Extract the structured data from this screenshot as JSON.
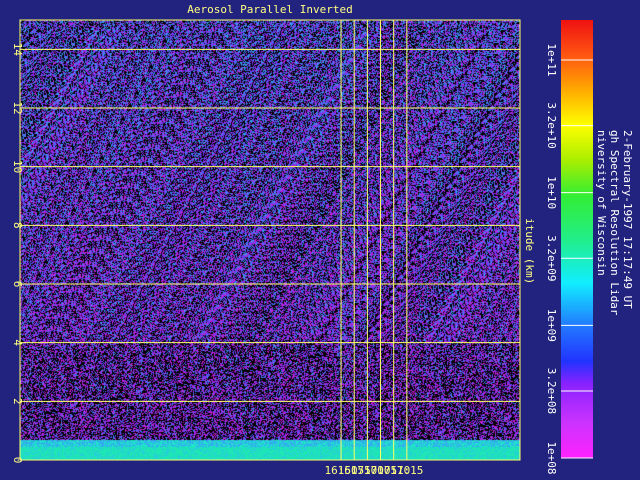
{
  "chart_data": {
    "type": "heatmap",
    "title": "Aerosol Parallel Inverted",
    "ylabel": "itude (km)",
    "xlim_minutes": [
      888,
      1078
    ],
    "ylim": [
      0,
      15
    ],
    "x_ticks": [
      "16:50",
      "16:55",
      "17:00",
      "17:05",
      "17:10",
      "17:15"
    ],
    "y_ticks": [
      "0",
      "2",
      "4",
      "6",
      "8",
      "10",
      "12",
      "14"
    ],
    "grid": true,
    "colorbar": {
      "scale": "log",
      "range": [
        100000000.0,
        200000000000.0
      ],
      "ticks": [
        "1e+08",
        "3.2e+08",
        "1e+09",
        "3.2e+09",
        "1e+10",
        "3.2e+10",
        "1e+11"
      ]
    },
    "side_text": [
      "niversity of Wisconsin",
      "gh Spectral Resolution Lidar",
      "2-February-1997 17:17:49 UT"
    ],
    "colors": {
      "background": "#22227f",
      "grid": "#ffff66",
      "plot_background": "#000000",
      "field_low": "#c81fd6",
      "field_mid": "#7a30f0",
      "field_high": "#2f8ff0",
      "surface_layer": "#1ee6b4"
    }
  }
}
